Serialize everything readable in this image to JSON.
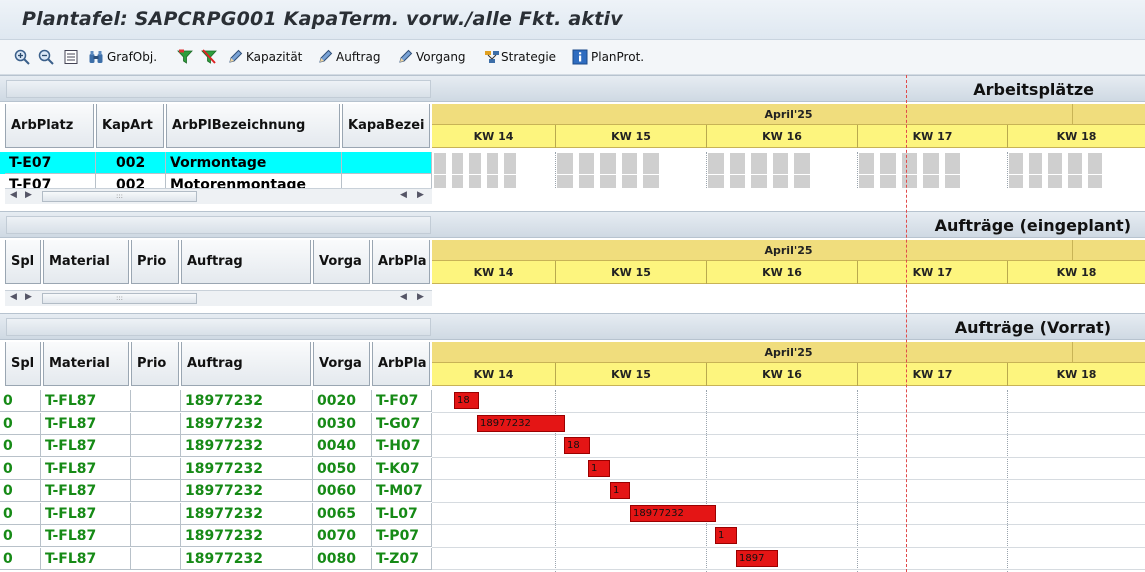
{
  "window": {
    "title": "Plantafel: SAPCRPG001 KapaTerm. vorw./alle Fkt. aktiv"
  },
  "toolbar": {
    "items": [
      {
        "label": "",
        "icon": "zoom-in-icon"
      },
      {
        "label": "",
        "icon": "zoom-out-icon"
      },
      {
        "label": "",
        "icon": "list-icon"
      },
      {
        "label": "GrafObj.",
        "icon": "binoculars-icon"
      },
      {
        "label": "",
        "icon": "filter-icon"
      },
      {
        "label": "",
        "icon": "filter-off-icon"
      },
      {
        "label": "Kapazität",
        "icon": "pencil-icon"
      },
      {
        "label": "Auftrag",
        "icon": "pencil-icon"
      },
      {
        "label": "Vorgang",
        "icon": "pencil-icon"
      },
      {
        "label": "Strategie",
        "icon": "strategy-icon"
      },
      {
        "label": "PlanProt.",
        "icon": "info-icon"
      }
    ]
  },
  "timeline": {
    "month": "April'25",
    "weeks": [
      "KW 14",
      "KW 15",
      "KW 16",
      "KW 17",
      "KW 18"
    ]
  },
  "arbeitsplaetze": {
    "title": "Arbeitsplätze",
    "columns": [
      "ArbPlatz",
      "KapArt",
      "ArbPlBezeichnung",
      "KapaBezei"
    ],
    "rows": [
      {
        "arbplatz": "T-E07",
        "kapart": "002",
        "bezeichnung": "Vormontage",
        "kapabez": ""
      },
      {
        "arbplatz": "T-F07",
        "kapart": "002",
        "bezeichnung": "Motorenmontage",
        "kapabez": ""
      }
    ]
  },
  "eingeplant": {
    "title": "Aufträge (eingeplant)",
    "columns": [
      "Spl",
      "Material",
      "Prio",
      "Auftrag",
      "Vorga",
      "ArbPla"
    ]
  },
  "vorrat": {
    "title": "Aufträge (Vorrat)",
    "columns": [
      "Spl",
      "Material",
      "Prio",
      "Auftrag",
      "Vorga",
      "ArbPla"
    ],
    "rows": [
      {
        "spl": "0",
        "material": "T-FL87",
        "prio": "",
        "auftrag": "18977232",
        "vorgang": "0020",
        "arbpla": "T-F07",
        "bar_label": "18"
      },
      {
        "spl": "0",
        "material": "T-FL87",
        "prio": "",
        "auftrag": "18977232",
        "vorgang": "0030",
        "arbpla": "T-G07",
        "bar_label": "18977232"
      },
      {
        "spl": "0",
        "material": "T-FL87",
        "prio": "",
        "auftrag": "18977232",
        "vorgang": "0040",
        "arbpla": "T-H07",
        "bar_label": "18"
      },
      {
        "spl": "0",
        "material": "T-FL87",
        "prio": "",
        "auftrag": "18977232",
        "vorgang": "0050",
        "arbpla": "T-K07",
        "bar_label": "1"
      },
      {
        "spl": "0",
        "material": "T-FL87",
        "prio": "",
        "auftrag": "18977232",
        "vorgang": "0060",
        "arbpla": "T-M07",
        "bar_label": "1"
      },
      {
        "spl": "0",
        "material": "T-FL87",
        "prio": "",
        "auftrag": "18977232",
        "vorgang": "0065",
        "arbpla": "T-L07",
        "bar_label": "18977232"
      },
      {
        "spl": "0",
        "material": "T-FL87",
        "prio": "",
        "auftrag": "18977232",
        "vorgang": "0070",
        "arbpla": "T-P07",
        "bar_label": "1"
      },
      {
        "spl": "0",
        "material": "T-FL87",
        "prio": "",
        "auftrag": "18977232",
        "vorgang": "0080",
        "arbpla": "T-Z07",
        "bar_label": "1897"
      }
    ]
  },
  "colors": {
    "selected_row": "#00ffff",
    "order_text": "#168a16",
    "bar": "#e41515",
    "month_band": "#f0dd7d",
    "week_band": "#fdf57e",
    "today_line": "#e04a4a"
  }
}
